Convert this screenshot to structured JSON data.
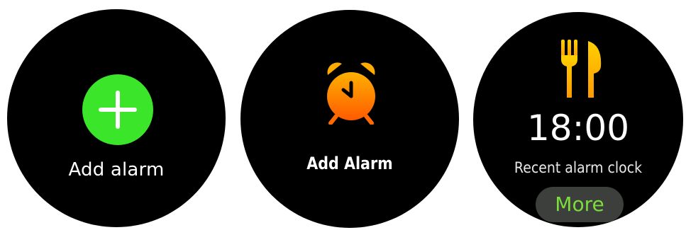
{
  "screens": [
    {
      "id": "add-alarm-plus",
      "label": "Add alarm",
      "icon": "plus-icon",
      "icon_color": "#3be52a"
    },
    {
      "id": "add-alarm-clock",
      "label": "Add Alarm",
      "icon": "alarm-clock-icon",
      "icon_color": "#ff7a00"
    },
    {
      "id": "recent-alarm",
      "icon": "cutlery-icon",
      "icon_color": "#ffb400",
      "time": "18:00",
      "subtitle": "Recent alarm clock",
      "button_label": "More",
      "button_color": "#7bdc3c"
    }
  ],
  "colors": {
    "watch_background": "#000000",
    "page_background": "#ffffff",
    "text": "#ffffff"
  }
}
